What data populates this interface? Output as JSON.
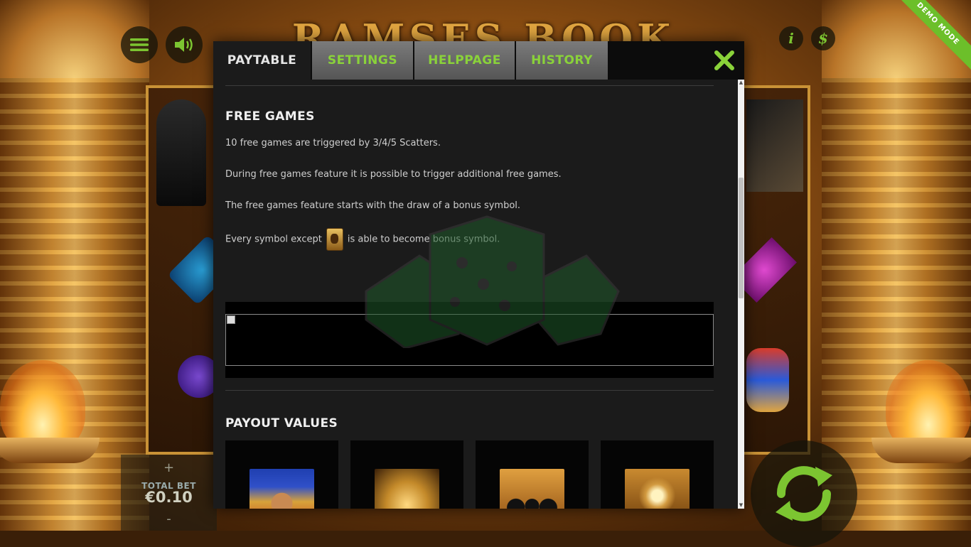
{
  "game": {
    "logo_text": "RAMSES BOOK",
    "demo_label": "DEMO MODE",
    "info_label": "i",
    "currency_label": "$",
    "bet": {
      "plus": "+",
      "label": "TOTAL BET",
      "value": "€0.10",
      "minus": "-"
    }
  },
  "dialog": {
    "tabs": [
      {
        "label": "PAYTABLE",
        "active": true
      },
      {
        "label": "SETTINGS",
        "active": false
      },
      {
        "label": "HELPPAGE",
        "active": false
      },
      {
        "label": "HISTORY",
        "active": false
      }
    ],
    "free_games": {
      "title": "FREE GAMES",
      "p1": "10 free games are triggered by 3/4/5 Scatters.",
      "p2": "During free games feature it is possible to trigger additional free games.",
      "p3": "The free games feature starts with the draw of a bonus symbol.",
      "p4_before": "Every symbol except",
      "p4_after": "is able to become bonus symbol."
    },
    "payout": {
      "title": "PAYOUT VALUES",
      "symbols": [
        "pharaoh-symbol",
        "pyramid-symbol",
        "cats-symbol",
        "falcon-symbol"
      ]
    }
  },
  "colors": {
    "accent": "#8ad23a",
    "dialog_bg": "#1b1b1b",
    "tab_bg": "#666666"
  }
}
